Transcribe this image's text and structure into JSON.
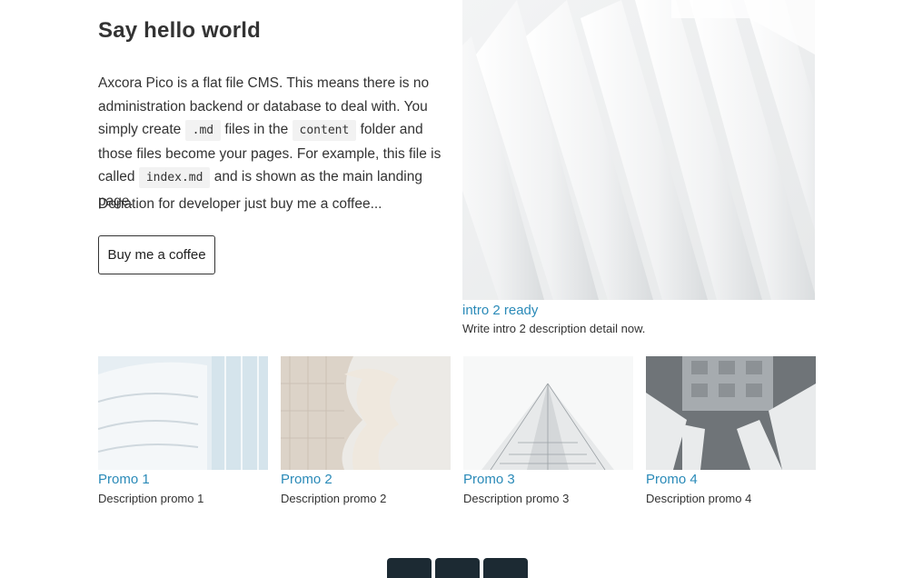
{
  "hero": {
    "title": "Say hello world",
    "intro": {
      "t1": "Axcora Pico is a flat file CMS. This means there is no administration backend or database to deal with. You simply create ",
      "code1": ".md",
      "t2": " files in the ",
      "code2": "content",
      "t3": " folder and those files become your pages. For example, this file is called ",
      "code3": "index.md",
      "t4": " and is shown as the main landing page."
    },
    "donation": "Donation for developer just buy me a coffee...",
    "button_label": "Buy me a coffee"
  },
  "intro2": {
    "link": "intro 2 ready",
    "description": "Write intro 2 description detail now."
  },
  "promos": [
    {
      "title": "Promo 1",
      "description": "Description promo 1"
    },
    {
      "title": "Promo 2",
      "description": "Description promo 2"
    },
    {
      "title": "Promo 3",
      "description": "Description promo 3"
    },
    {
      "title": "Promo 4",
      "description": "Description promo 4"
    }
  ],
  "colors": {
    "link": "#2a8ab8",
    "pager": "#1c2a33"
  }
}
